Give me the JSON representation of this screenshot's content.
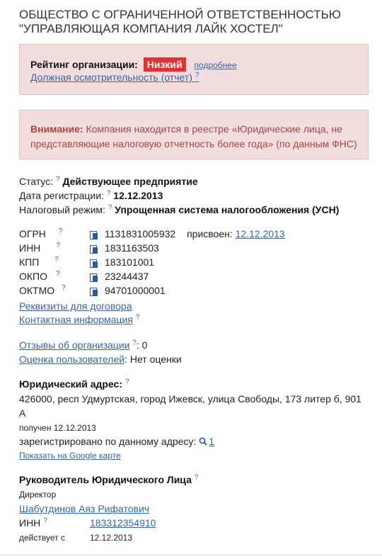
{
  "header": {
    "title": "ОБЩЕСТВО С ОГРАНИЧЕННОЙ ОТВЕТСТВЕННОСТЬЮ \"УПРАВЛЯЮЩАЯ КОМПАНИЯ ЛАЙК ХОСТЕЛ\""
  },
  "rating": {
    "label": "Рейтинг организации:",
    "badge": "Низкий",
    "badge_color": "#e03232",
    "more_link": "подробнее",
    "due_diligence_link": "Должная осмотрительность (отчет)",
    "help_mark": "?"
  },
  "warning": {
    "label": "Внимание:",
    "text": "Компания находится в реестре «Юридические лица, не представляющие налоговую отчетность более года» (по данным ФНС)"
  },
  "status": {
    "status_label": "Статус:",
    "status_value": "Действующее предприятие",
    "reg_label": "Дата регистрации:",
    "reg_value": "12.12.2013",
    "tax_label": "Налоговый режим:",
    "tax_value": "Упрощенная система налогообложения (УСН)"
  },
  "codes": {
    "ogrn_label": "ОГРН",
    "ogrn_value": "1131831005932",
    "assigned_label": "присвоен:",
    "assigned_value": "12.12.2013",
    "inn_label": "ИНН",
    "inn_value": "1831163503",
    "kpp_label": "КПП",
    "kpp_value": "183101001",
    "okpo_label": "ОКПО",
    "okpo_value": "23244437",
    "oktmo_label": "ОКТМО",
    "oktmo_value": "94701000001"
  },
  "links": {
    "requisites": "Реквизиты для договора",
    "contacts": "Контактная информация",
    "reviews": "Отзывы об организации",
    "reviews_count": ": 0",
    "user_rating": "Оценка пользователей",
    "user_rating_value": ": Нет оценки"
  },
  "address": {
    "heading": "Юридический адрес:",
    "line1": "426000, респ Удмуртская, город Ижевск, улица Свободы, 173 литер б, 901",
    "line2": "А",
    "received": "получен 12.12.2013",
    "registered_label": "зарегистрировано по данному адресу:",
    "registered_count": "1",
    "map_link": "Показать на Google карте"
  },
  "head": {
    "heading": "Руководитель Юридического Лица",
    "position": "Директор",
    "name": "Шабутдинов Аяз Рифатович",
    "inn_label": "ИНН",
    "inn_value": "183312354910",
    "since_label": "действует с",
    "since_value": "12.12.2013"
  }
}
